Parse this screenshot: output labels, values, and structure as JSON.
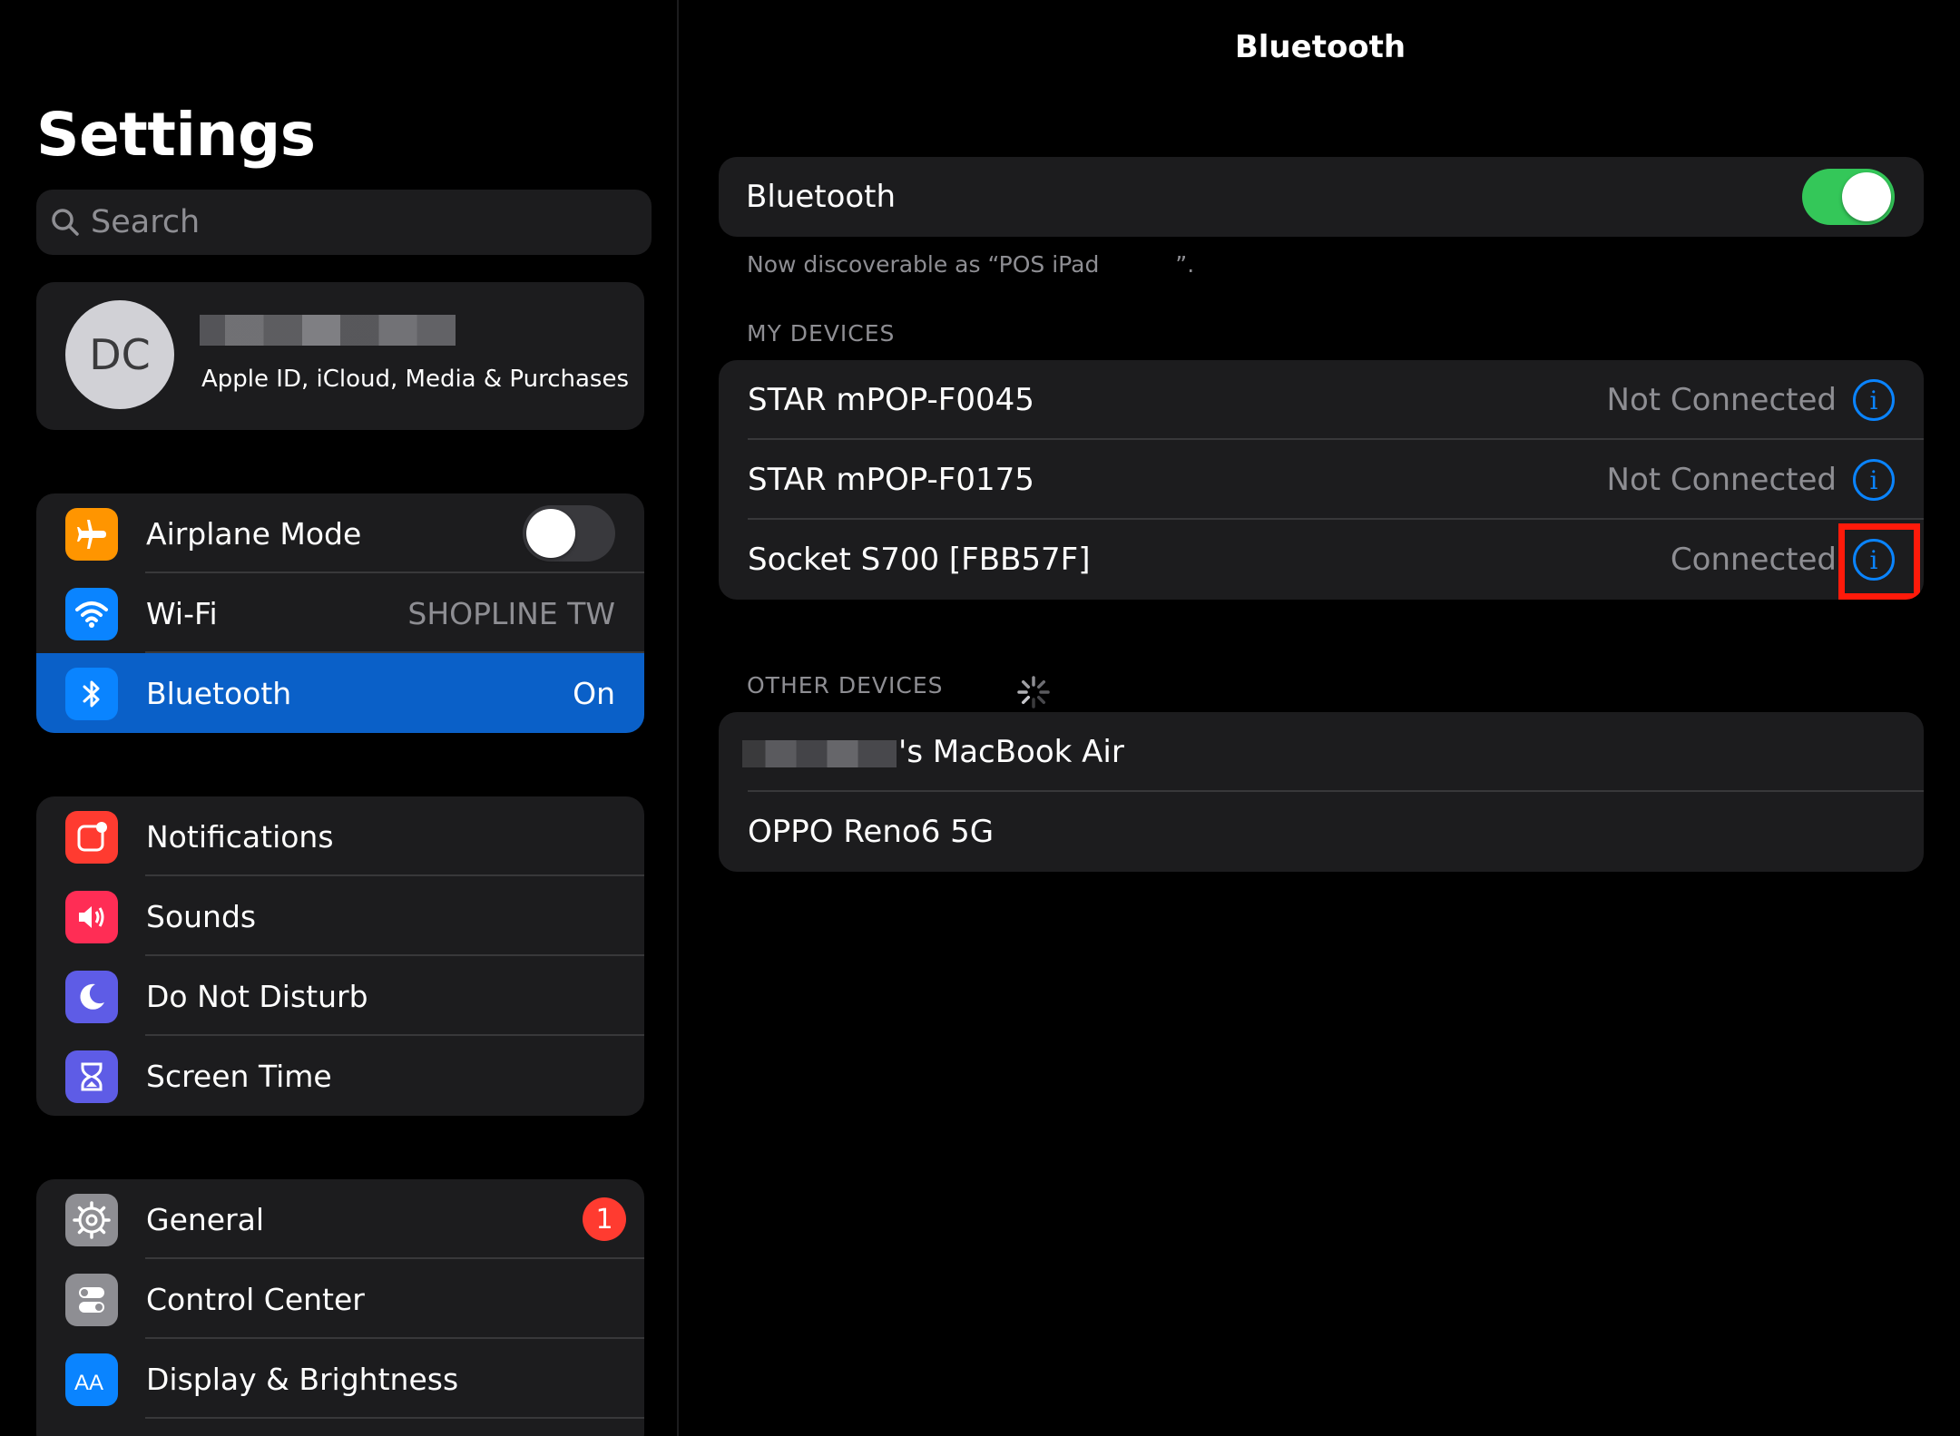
{
  "sidebar": {
    "title": "Settings",
    "search_placeholder": "Search",
    "profile": {
      "initials": "DC",
      "subtitle": "Apple ID, iCloud, Media & Purchases"
    },
    "group1": [
      {
        "label": "Airplane Mode",
        "icon": "airplane-icon",
        "color": "#ff9500"
      },
      {
        "label": "Wi-Fi",
        "value": "SHOPLINE TW",
        "icon": "wifi-icon",
        "color": "#0a84ff"
      },
      {
        "label": "Bluetooth",
        "value": "On",
        "icon": "bluetooth-icon",
        "color": "#0a84ff"
      }
    ],
    "group2": [
      {
        "label": "Notifications",
        "icon": "notifications-icon",
        "color": "#ff3b30"
      },
      {
        "label": "Sounds",
        "icon": "speaker-icon",
        "color": "#ff2d55"
      },
      {
        "label": "Do Not Disturb",
        "icon": "moon-icon",
        "color": "#5e5ce6"
      },
      {
        "label": "Screen Time",
        "icon": "hourglass-icon",
        "color": "#5e5ce6"
      }
    ],
    "group3": [
      {
        "label": "General",
        "badge": "1",
        "icon": "gear-icon",
        "color": "#8e8e93"
      },
      {
        "label": "Control Center",
        "icon": "switches-icon",
        "color": "#8e8e93"
      },
      {
        "label": "Display & Brightness",
        "icon": "text-size-icon",
        "color": "#0a84ff"
      }
    ]
  },
  "detail": {
    "title": "Bluetooth",
    "toggle_label": "Bluetooth",
    "discoverable_prefix": "Now discoverable as “POS iPad ",
    "discoverable_suffix": "”.",
    "my_devices_header": "MY DEVICES",
    "my_devices": [
      {
        "name": "STAR mPOP-F0045",
        "status": "Not Connected"
      },
      {
        "name": "STAR mPOP-F0175",
        "status": "Not Connected"
      },
      {
        "name": "Socket S700 [FBB57F]",
        "status": "Connected"
      }
    ],
    "other_devices_header": "OTHER DEVICES",
    "other_devices": [
      {
        "name": "'s MacBook Air"
      },
      {
        "name": "OPPO Reno6 5G"
      }
    ],
    "info_glyph": "i"
  }
}
